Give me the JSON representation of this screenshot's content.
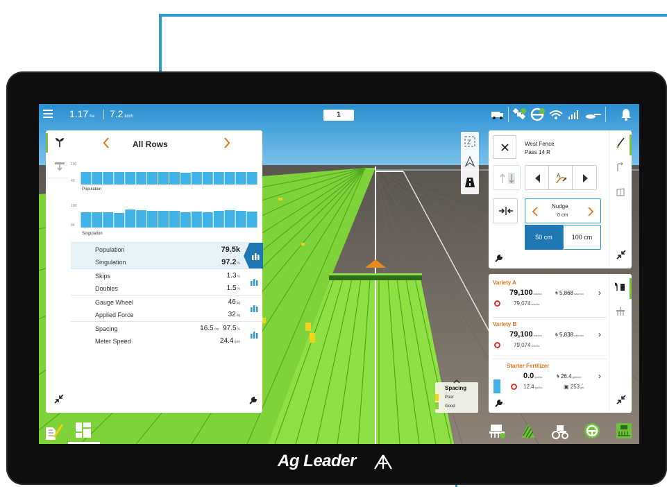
{
  "topbar": {
    "area_value": "1.17",
    "area_unit": "ha",
    "speed_value": "7.2",
    "speed_unit": "km/h",
    "pass_number": "1",
    "icons": [
      "menu-icon",
      "truck-icon",
      "satellite-icon",
      "steering-icon",
      "wifi-icon",
      "signal-icon",
      "planter-icon",
      "bell-icon"
    ]
  },
  "left_panel": {
    "title": "All Rows",
    "population_chart": {
      "label": "Population",
      "axis_top": "100",
      "axis_bottom": "40"
    },
    "singulation_chart": {
      "label": "Singulation",
      "axis_top": "100",
      "axis_bottom": "84"
    },
    "metrics": [
      {
        "label1": "Population",
        "value1": "79.5k",
        "unit1": "",
        "label2": "Singulation",
        "value2": "97.2",
        "unit2": "%"
      },
      {
        "label1": "Skips",
        "value1": "1.3",
        "unit1": "%",
        "label2": "Doubles",
        "value2": "1.5",
        "unit2": "%"
      },
      {
        "label1": "Gauge Wheel",
        "value1": "46",
        "unit1": "kg",
        "label2": "Applied Force",
        "value2": "32",
        "unit2": "kg"
      },
      {
        "label1": "Spacing",
        "value1": "16.5",
        "unit1": "cm",
        "value1b": "97.5",
        "unit1b": "%",
        "label2": "Meter Speed",
        "value2": "24.4",
        "unit2": "rpm"
      }
    ]
  },
  "guidance_panel": {
    "line_name": "West Fence",
    "pass_name": "Pass 14 R",
    "nudge_label": "Nudge",
    "nudge_value": "0",
    "nudge_unit": "cm",
    "step_options": [
      "50 cm",
      "100 cm"
    ],
    "selected_step": "50 cm"
  },
  "seed_panel": {
    "products": [
      {
        "name": "Variety A",
        "rate": "79,100",
        "rate_unit": "sds/ha",
        "speed": "5,868",
        "speed_unit": "sds/min",
        "target": "79,074",
        "target_unit": "sds/ha"
      },
      {
        "name": "Variety B",
        "rate": "79,100",
        "rate_unit": "sds/ha",
        "speed": "5,838",
        "speed_unit": "sds/min",
        "target": "79,074",
        "target_unit": "sds/ha"
      },
      {
        "name": "Starter Fertilizer",
        "rate": "0.0",
        "rate_unit": "gal/ha",
        "speed": "26.4",
        "speed_unit": "gal/min",
        "target": "12.4",
        "target_unit": "gal/ha",
        "tank": "253",
        "tank_unit": "gal"
      }
    ]
  },
  "spacing_legend": {
    "title": "Spacing",
    "items": [
      {
        "label": "Poor",
        "color": "#f2d21b"
      },
      {
        "label": "Good",
        "color": "#8ccf3c"
      }
    ]
  },
  "brand": {
    "name": "Ag Leader"
  },
  "colors": {
    "accent_blue": "#1f78b4",
    "callout_blue": "#2d9ad4",
    "field_green": "#7fd23a",
    "variety_orange": "#e2731c"
  }
}
